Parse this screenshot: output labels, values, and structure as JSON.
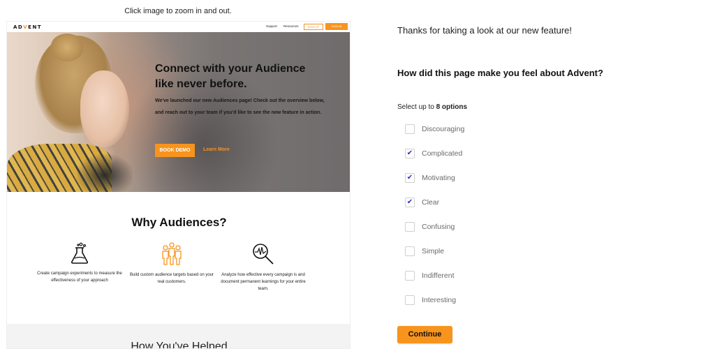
{
  "hint": "Click image to zoom in and out.",
  "preview": {
    "logo": {
      "prefix": "AD",
      "accent": "V",
      "suffix": "ENT"
    },
    "nav": {
      "support": "Support",
      "resources": "Resources",
      "signup": "SIGN UP",
      "signin": "SIGN IN"
    },
    "hero": {
      "title": "Connect with your Audience like never before.",
      "subtitle": "We've launched our new Audiences page! Check out the overview below, and reach out to your team if you'd like to see the new feature in action.",
      "book_demo": "BOOK DEMO",
      "learn_more": "Learn More"
    },
    "why_title": "Why Audiences?",
    "features": [
      {
        "icon": "flask-icon",
        "text": "Create campaign experiments to measure the effectiveness of your approach"
      },
      {
        "icon": "people-icon",
        "text": "Build custom audience targets based on your real customers."
      },
      {
        "icon": "magnifier-chart-icon",
        "text": "Analyze how effective every campaign is and document permanent learnings for your entire team."
      }
    ],
    "helped_title": "How You've Helped"
  },
  "survey": {
    "thanks": "Thanks for taking a look at our new feature!",
    "question": "How did this page make you feel about Advent?",
    "select_prefix": "Select up to ",
    "select_count": "8 options",
    "options": [
      {
        "label": "Discouraging",
        "checked": false
      },
      {
        "label": "Complicated",
        "checked": true
      },
      {
        "label": "Motivating",
        "checked": true
      },
      {
        "label": "Clear",
        "checked": true
      },
      {
        "label": "Confusing",
        "checked": false
      },
      {
        "label": "Simple",
        "checked": false
      },
      {
        "label": "Indifferent",
        "checked": false
      },
      {
        "label": "Interesting",
        "checked": false
      }
    ],
    "continue": "Continue"
  },
  "colors": {
    "accent": "#f7941d",
    "check": "#2b2fb8"
  }
}
